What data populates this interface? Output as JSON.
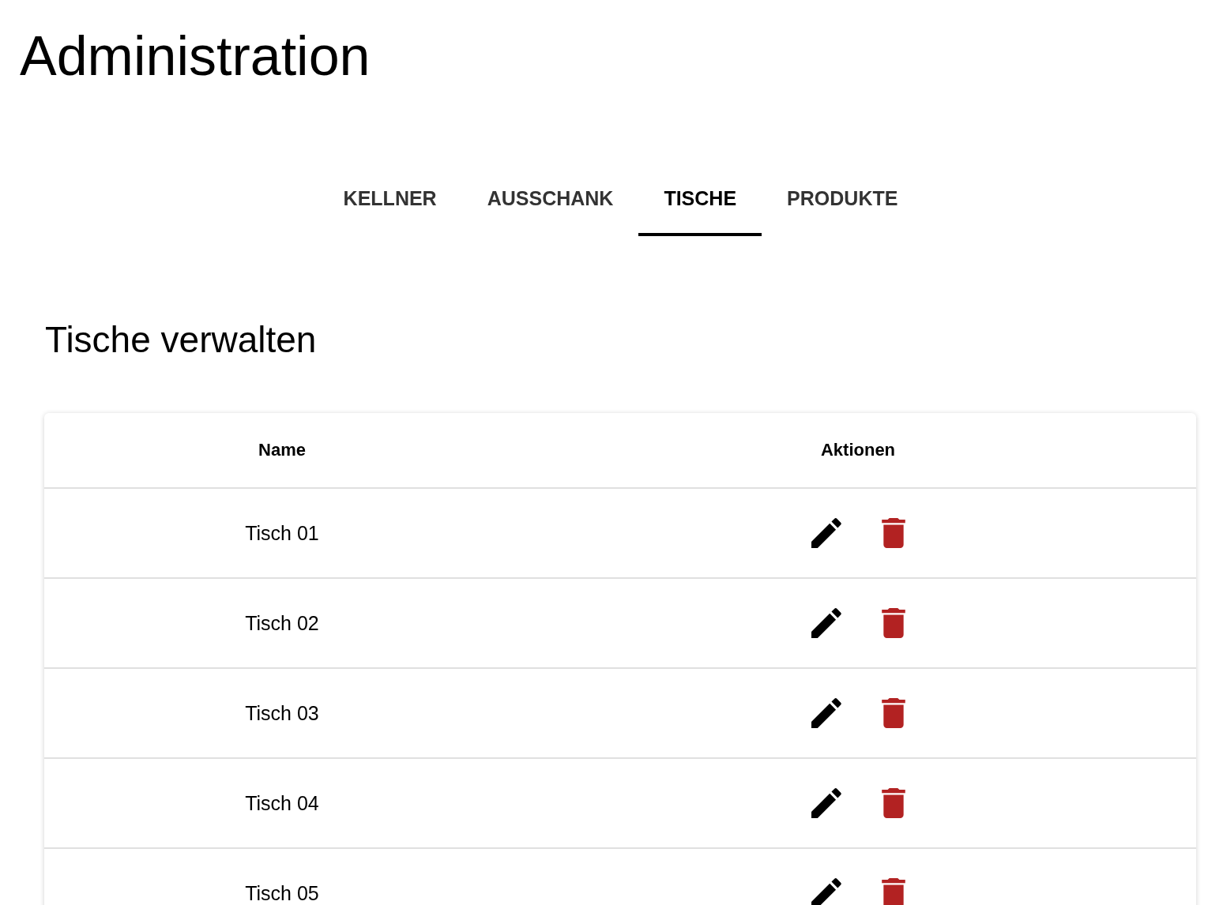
{
  "page": {
    "title": "Administration"
  },
  "tabs": [
    {
      "label": "KELLNER",
      "selected": false
    },
    {
      "label": "AUSSCHANK",
      "selected": false
    },
    {
      "label": "TISCHE",
      "selected": true
    },
    {
      "label": "PRODUKTE",
      "selected": false
    }
  ],
  "section": {
    "title": "Tische verwalten"
  },
  "table": {
    "columns": [
      "Name",
      "Aktionen"
    ],
    "rows": [
      {
        "name": "Tisch 01"
      },
      {
        "name": "Tisch 02"
      },
      {
        "name": "Tisch 03"
      },
      {
        "name": "Tisch 04"
      },
      {
        "name": "Tisch 05"
      }
    ]
  }
}
